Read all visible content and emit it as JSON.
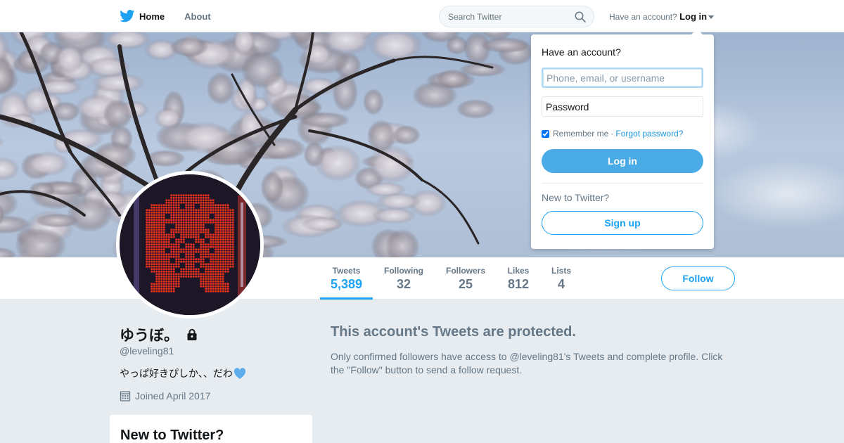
{
  "nav": {
    "home_label": "Home",
    "about_label": "About",
    "search_placeholder": "Search Twitter",
    "account_prompt": "Have an account?",
    "login_label": "Log in"
  },
  "profile": {
    "name": "ゆうぼ。",
    "handle": "@leveling81",
    "bio": "やっぱ好きぴしか、、だわ",
    "joined": "Joined April 2017",
    "protected": true
  },
  "stats": [
    {
      "label": "Tweets",
      "value": "5,389",
      "active": true
    },
    {
      "label": "Following",
      "value": "32",
      "active": false
    },
    {
      "label": "Followers",
      "value": "25",
      "active": false
    },
    {
      "label": "Likes",
      "value": "812",
      "active": false
    },
    {
      "label": "Lists",
      "value": "4",
      "active": false
    }
  ],
  "follow_label": "Follow",
  "protected_notice": {
    "title": "This account's Tweets are protected.",
    "body": "Only confirmed followers have access to @leveling81's Tweets and complete profile. Click the \"Follow\" button to send a follow request."
  },
  "sidebar": {
    "new_to_twitter": "New to Twitter?"
  },
  "login_dropdown": {
    "title": "Have an account?",
    "username_placeholder": "Phone, email, or username",
    "password_placeholder": "Password",
    "remember_label": "Remember me",
    "separator": "·",
    "forgot_label": "Forgot password?",
    "remember_checked": true,
    "login_button": "Log in",
    "new_prompt": "New to Twitter?",
    "signup_button": "Sign up"
  },
  "colors": {
    "accent": "#1da1f2",
    "login_button": "#4aabe7",
    "page_bg": "#e6ecf0"
  },
  "icons": [
    "twitter-bird-icon",
    "search-icon",
    "caret-down-icon",
    "lock-icon",
    "blue-heart-icon",
    "calendar-icon"
  ]
}
